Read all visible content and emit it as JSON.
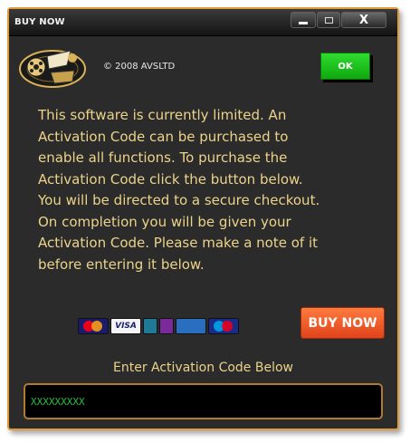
{
  "window": {
    "title": "BUY NOW",
    "close_label": "X"
  },
  "header": {
    "copyright": "© 2008 AVSLTD",
    "ok_label": "OK"
  },
  "message": {
    "lines": [
      "This software is currently limited. An",
      "Activation Code can be purchased to",
      "enable all functions. To purchase the",
      "Activation Code click the button below.",
      "You will be directed to a secure checkout.",
      "On completion you will be given your",
      "Activation Code. Please make a note of it",
      "before entering it below."
    ]
  },
  "payment": {
    "cards": [
      "mastercard-icon",
      "visa-icon",
      "jcb-icon",
      "solo-icon",
      "visa-electron-icon",
      "maestro-icon"
    ],
    "visa_text": "VISA",
    "buy_label": "BUY NOW"
  },
  "activation": {
    "label": "Enter Activation Code Below",
    "value": "XXXXXXXXX"
  },
  "colors": {
    "accent": "#e09a3c",
    "text": "#ecd38a",
    "ok": "#1cc41c",
    "buy": "#f05a28",
    "input_text": "#22c23a"
  }
}
